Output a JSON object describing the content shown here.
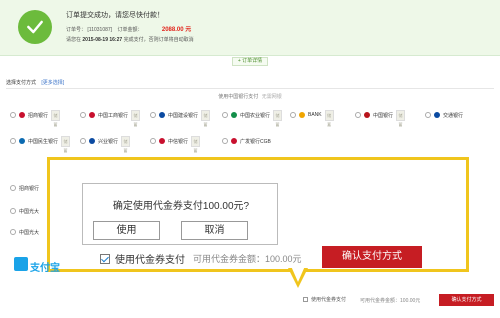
{
  "banner": {
    "success_text": "订单提交成功，请您尽快付款！",
    "order_label": "订单号：",
    "order_no": "[11031087]",
    "amount_label": "订单金额：",
    "amount": "2088.00 元",
    "deadline_label": "请您在",
    "deadline_time": "2015-08-19 16:27",
    "deadline_suffix": "完成支付，否则订单将自动取消",
    "detail_link": "+ 订单详情"
  },
  "methods": {
    "heading": "选择支付方式",
    "change_link": "[更多选择]",
    "bank_caption": "使用中国银行支付",
    "bank_caption_extra": "无需网银",
    "row1": [
      {
        "name": "招商银行",
        "color": "#c8102e"
      },
      {
        "name": "中国工商银行",
        "color": "#c8102e"
      },
      {
        "name": "中国建设银行",
        "color": "#0b4aa1"
      },
      {
        "name": "中国农业银行",
        "color": "#138f4a"
      },
      {
        "name": "BANK",
        "color": "#f0a500"
      },
      {
        "name": "中国银行",
        "color": "#b8141b"
      },
      {
        "name": "交通银行",
        "color": "#0b4aa1"
      }
    ],
    "row2": [
      {
        "name": "中国民生银行",
        "color": "#0b6ab1"
      },
      {
        "name": "兴业银行",
        "color": "#0b4aa1"
      },
      {
        "name": "中信银行",
        "color": "#c8102e"
      },
      {
        "name": "广发银行CGB",
        "color": "#c8102e"
      }
    ],
    "tag_text": "储蓄",
    "ghost_rows": [
      "招商银行",
      "中国光大",
      "中国光大"
    ]
  },
  "dialog": {
    "question": "确定使用代金券支付100.00元?",
    "use_button": "使用",
    "cancel_button": "取消"
  },
  "voucher": {
    "checkbox_label": "使用代金券支付",
    "available_label": "可用代金券金额：100.00元",
    "confirm_button": "确认支付方式"
  },
  "alipay": {
    "label": "支付宝"
  },
  "bottom": {
    "checkbox_label": "使用代金券支付",
    "available_label": "可用代金券金额：100.00元",
    "confirm_button": "确认支付方式"
  },
  "colors": {
    "success_green": "#6cbb3c",
    "highlight_yellow": "#f0c51d",
    "confirm_red": "#c61d23"
  }
}
